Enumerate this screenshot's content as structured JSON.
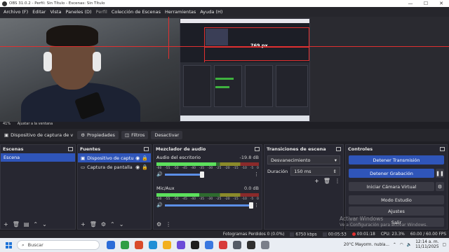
{
  "window": {
    "title": "OBS 31.0.2 - Perfil: Sin Título - Escenas: Sin Título",
    "controls": [
      "—",
      "☐",
      "✕"
    ]
  },
  "menu": [
    "Archivo (F)",
    "Editar",
    "Vista",
    "Paneles (D)",
    "Perfil",
    "Colección de Escenas",
    "Herramientas",
    "Ayuda (H)"
  ],
  "preview": {
    "dimension_label": "769 px",
    "zoom": "41%",
    "fit_label": "Ajustar a la ventana"
  },
  "source_toolbar": {
    "source_name": "Dispositivo de captura de v",
    "properties": "Propiedades",
    "filters": "Filtros",
    "deactivate": "Desactivar"
  },
  "scenes": {
    "title": "Escenas",
    "items": [
      "Escena"
    ]
  },
  "sources": {
    "title": "Fuentes",
    "items": [
      {
        "label": "Dispositivo de captura d",
        "selected": true
      },
      {
        "label": "Captura de pantalla",
        "selected": false
      }
    ]
  },
  "mixer": {
    "title": "Mezclador de audio",
    "ticks": [
      "-60",
      "-55",
      "-50",
      "-45",
      "-40",
      "-35",
      "-30",
      "-25",
      "-20",
      "-15",
      "-10",
      "-5",
      "0"
    ],
    "channels": [
      {
        "name": "Audio del escritorio",
        "db": "-19.8 dB",
        "level": 0.58
      },
      {
        "name": "Mic/Aux",
        "db": "0.0 dB",
        "level": 0.42
      }
    ]
  },
  "transitions": {
    "title": "Transiciones de escena",
    "type": "Desvanecimiento",
    "duration_label": "Duración",
    "duration": "150 ms"
  },
  "controls": {
    "title": "Controles",
    "stream": "Detener Transmisión",
    "record": "Detener Grabación",
    "virtual_cam": "Iniciar Cámara Virtual",
    "studio": "Modo Estudio",
    "settings": "Ajustes",
    "exit": "Salir"
  },
  "watermark": {
    "line1": "Activar Windows",
    "line2": "Ve a Configuración para activar Windows."
  },
  "status": {
    "dropped": "Fotogramas Perdidos 0 (0.0%)",
    "bitrate": "6750 kbps",
    "stream_time": "00:05:53",
    "rec_time": "00:01:18",
    "cpu": "CPU: 23.3%",
    "fps": "60.00 / 60.00 FPS"
  },
  "taskbar": {
    "search_placeholder": "Buscar",
    "weather": "20°C  Mayorm. nubla...",
    "time": "12:14 a. m.",
    "date": "11/11/2025",
    "icon_colors": [
      "#2b6cd8",
      "#2f9e44",
      "#d94b2b",
      "#1f8fd6",
      "#f2b01e",
      "#6c4bd8",
      "#1e1e1e",
      "#3a78e0",
      "#d83a3a",
      "#555b66",
      "#2f2f2f",
      "#7a7f8a"
    ]
  },
  "colors": {
    "accent": "#2f55b9",
    "record_red": "#e03030",
    "meter_green": "#5ce05c"
  }
}
